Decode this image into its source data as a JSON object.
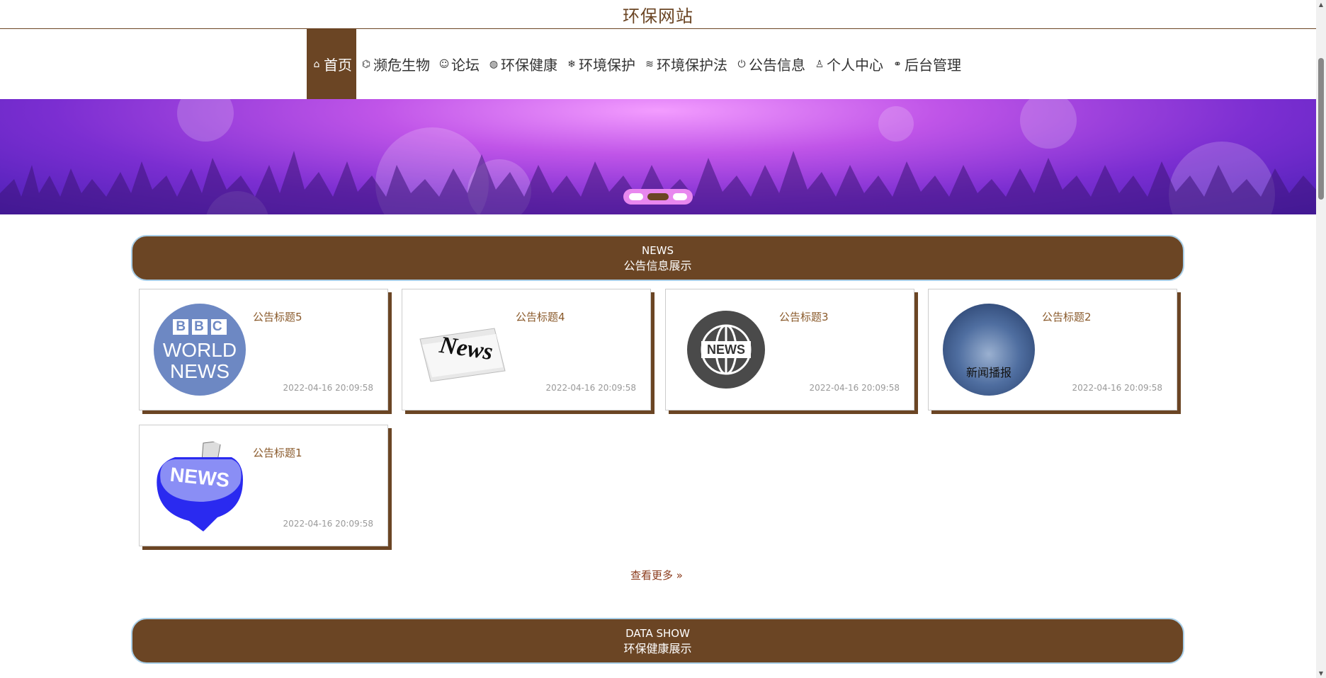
{
  "site": {
    "title": "环保网站"
  },
  "nav": {
    "items": [
      {
        "label": "首页",
        "icon": "⌂"
      },
      {
        "label": "濒危生物",
        "icon": "⌬"
      },
      {
        "label": "论坛",
        "icon": "☺"
      },
      {
        "label": "环保健康",
        "icon": "◍"
      },
      {
        "label": "环境保护",
        "icon": "❄"
      },
      {
        "label": "环境保护法",
        "icon": "≋"
      },
      {
        "label": "公告信息",
        "icon": "⏻"
      },
      {
        "label": "个人中心",
        "icon": "♙"
      },
      {
        "label": "后台管理",
        "icon": "⚭"
      }
    ]
  },
  "news_section": {
    "en": "NEWS",
    "zh": "公告信息展示"
  },
  "news": [
    {
      "title": "公告标题5",
      "time": "2022-04-16 20:09:58",
      "thumb": "bbc"
    },
    {
      "title": "公告标题4",
      "time": "2022-04-16 20:09:58",
      "thumb": "newspaper"
    },
    {
      "title": "公告标题3",
      "time": "2022-04-16 20:09:58",
      "thumb": "globe"
    },
    {
      "title": "公告标题2",
      "time": "2022-04-16 20:09:58",
      "thumb": "broadcast"
    },
    {
      "title": "公告标题1",
      "time": "2022-04-16 20:09:58",
      "thumb": "news-blue"
    }
  ],
  "thumbs": {
    "bbc": {
      "line1": "BBC",
      "line2": "WORLD",
      "line3": "NEWS"
    },
    "newspaper": {
      "text": "News"
    },
    "globe": {
      "text": "NEWS"
    },
    "broadcast": {
      "text": "新闻播报"
    },
    "news_blue": {
      "text": "NEWS"
    }
  },
  "more_label": "查看更多",
  "more_icon": "»",
  "data_section": {
    "en": "DATA SHOW",
    "zh": "环保健康展示"
  },
  "colors": {
    "brand": "#6b4524",
    "title": "#8a5a2b",
    "time": "#999999"
  }
}
